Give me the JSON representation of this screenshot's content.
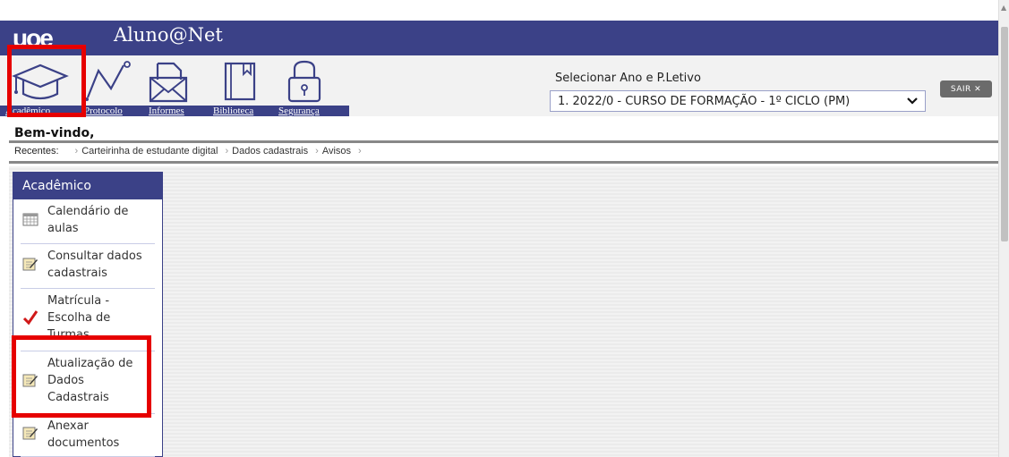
{
  "header": {
    "logo_text": "ᴜᴏe",
    "app_title": "Aluno@Net",
    "bg_color": "#3b4187"
  },
  "toolbar": {
    "tools": [
      {
        "name": "academico",
        "label": "Acadêmico",
        "icon": "graduation-cap-icon"
      },
      {
        "name": "protocolo",
        "label": "Protocolo",
        "icon": "line-chart-icon"
      },
      {
        "name": "informes",
        "label": "Informes",
        "icon": "envelope-icon"
      },
      {
        "name": "biblioteca",
        "label": "Biblioteca",
        "icon": "book-icon"
      },
      {
        "name": "seguranca",
        "label": "Segurança",
        "icon": "padlock-icon"
      }
    ],
    "year_label": "Selecionar Ano e P.Letivo",
    "year_selected": "1. 2022/0 - CURSO DE FORMAÇÃO - 1º CICLO (PM)",
    "logout_label": "SAIR ✕"
  },
  "welcome": {
    "text": "Bem-vindo,"
  },
  "recent": {
    "label": "Recentes:",
    "items": [
      "Carteirinha de estudante digital",
      "Dados cadastrais",
      "Avisos"
    ]
  },
  "sidebar": {
    "title": "Acadêmico",
    "items": [
      {
        "label": "Calendário de\naulas",
        "icon": "calendar-grid-icon"
      },
      {
        "label": "Consultar dados\ncadastrais",
        "icon": "notepad-edit-icon"
      },
      {
        "label": "Matrícula -\nEscolha de\nTurmas",
        "icon": "red-check-icon"
      },
      {
        "label": "Atualização de\nDados\nCadastrais",
        "icon": "notepad-edit-icon"
      },
      {
        "label": "Anexar\ndocumentos",
        "icon": "notepad-edit-icon"
      }
    ]
  },
  "highlight_color": "#e60000"
}
